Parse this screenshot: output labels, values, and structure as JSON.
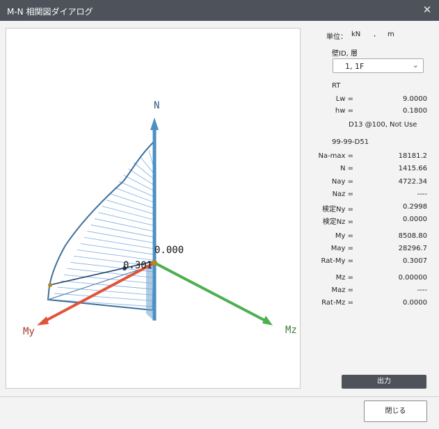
{
  "window": {
    "title": "M-N 相関図ダイアログ",
    "close_glyph": "✕"
  },
  "viewport": {
    "axes": {
      "n": "N",
      "my": "My",
      "mz": "Mz"
    },
    "labels": {
      "origin_value": "0.000",
      "point_value": "0.301"
    },
    "colors": {
      "n_axis": "#4a90c4",
      "my_axis": "#e0543a",
      "mz_axis": "#4caf50",
      "mesh": "#8ab4e6",
      "outline": "#3e6f9a"
    }
  },
  "panel": {
    "unit_label": "単位：",
    "unit_force": "kN",
    "unit_sep": ",",
    "unit_length": "m",
    "wall_label": "壁ID, 層",
    "wall_select_value": "1,   1F",
    "section_name": "RT",
    "section_rows": [
      {
        "label": "Lw =",
        "value": "9.0000"
      },
      {
        "label": "hw =",
        "value": "0.1800"
      }
    ],
    "rebar_note": "D13 @100,   Not Use",
    "case_name": "99-99-D51",
    "result_rows": [
      {
        "label": "Na-max =",
        "value": "18181.2"
      },
      {
        "label": "N =",
        "value": "1415.66"
      },
      {
        "label": "Nay =",
        "value": "4722.34"
      },
      {
        "label": "Naz =",
        "value": "----"
      },
      {
        "label": "検定Ny =",
        "value": "0.2998"
      },
      {
        "label": "検定Nz =",
        "value": "0.0000"
      },
      {
        "label": "My =",
        "value": "8508.80"
      },
      {
        "label": "May =",
        "value": "28296.7"
      },
      {
        "label": "Rat-My =",
        "value": "0.3007"
      },
      {
        "label": "Mz =",
        "value": "0.00000"
      },
      {
        "label": "Maz =",
        "value": "----"
      },
      {
        "label": "Rat-Mz =",
        "value": "0.0000"
      }
    ],
    "output_button": "出力"
  },
  "footer": {
    "close_button": "閉じる"
  }
}
